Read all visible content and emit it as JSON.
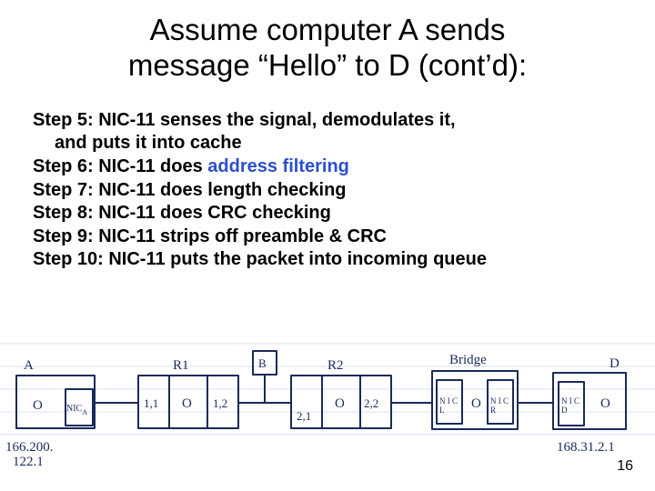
{
  "title_line1": "Assume computer A sends",
  "title_line2": "message “Hello” to D (cont’d):",
  "steps": {
    "s5a": "Step 5: NIC-11 senses the signal, demodulates it,",
    "s5b": "and puts it into cache",
    "s6a": "Step 6: NIC-11 does ",
    "s6b": "address filtering",
    "s7": "Step 7: NIC-11 does length checking",
    "s8": "Step 8: NIC-11 does CRC checking",
    "s9": "Step 9: NIC-11 strips off preamble & CRC",
    "s10": "Step 10: NIC-11 puts the packet into incoming queue"
  },
  "page_number": "16",
  "diagram": {
    "nodes": {
      "A": {
        "label": "A",
        "sub": "O",
        "nic": "NIC_A"
      },
      "R1": {
        "label": "R1",
        "left": "1,1",
        "mid": "O",
        "right": "1,2"
      },
      "B": {
        "label": "B"
      },
      "R2": {
        "label": "R2",
        "left": "2,1",
        "mid": "O",
        "right": "2,2"
      },
      "Bridge": {
        "label": "Bridge",
        "nicL": "NIC_L",
        "nicR": "NIC_R"
      },
      "D": {
        "label": "D",
        "sub": "O",
        "nic": "NIC_D"
      }
    },
    "ip_left": "166.200.\n122.1",
    "ip_right": "168.31.2.1"
  }
}
